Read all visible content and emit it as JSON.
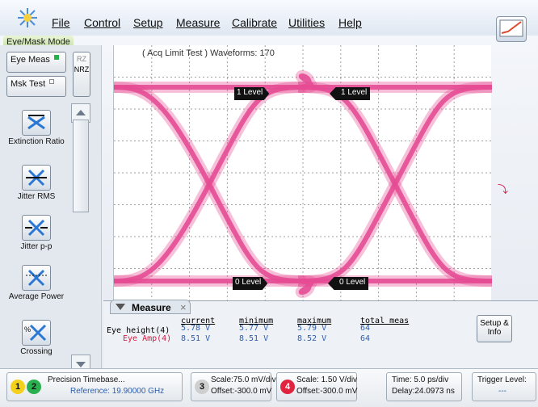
{
  "menubar": {
    "items": [
      "File",
      "Control",
      "Setup",
      "Measure",
      "Calibrate",
      "Utilities",
      "Help"
    ],
    "mode_label": "Eye/Mask Mode",
    "logo_icon": "starburst-icon",
    "help_icon": "oscilloscope-icon"
  },
  "left_panel": {
    "eye_meas_label": "Eye Meas",
    "msk_test_label": "Msk Test",
    "rz_label": "RZ",
    "nrz_label": "NRZ",
    "measurements": [
      {
        "label": "Extinction Ratio",
        "icon": "extinction-ratio-icon"
      },
      {
        "label": "Jitter RMS",
        "icon": "jitter-rms-icon"
      },
      {
        "label": "Jitter p-p",
        "icon": "jitter-pp-icon"
      },
      {
        "label": "Average Power",
        "icon": "average-power-icon"
      },
      {
        "label": "Crossing Percentage",
        "icon": "crossing-percentage-icon"
      }
    ]
  },
  "scope": {
    "acq_info": "( Acq Limit Test )  Waveforms: 170",
    "marker_1_level": "1 Level",
    "marker_0_level": "0 Level",
    "trace_color": "#e54b93"
  },
  "measure_panel": {
    "tab_label": "Measure",
    "headers": {
      "current": "current",
      "minimum": "minimum",
      "maximum": "maximum",
      "total_meas": "total meas"
    },
    "rows": [
      {
        "name": "Eye height(4)",
        "current": "5.78 V",
        "minimum": "5.77 V",
        "maximum": "5.79 V",
        "total": "64",
        "color": "#000000"
      },
      {
        "name": "Eye Amp(4)",
        "current": "8.51 V",
        "minimum": "8.51 V",
        "maximum": "8.52 V",
        "total": "64",
        "color": "#d71a41"
      }
    ],
    "setup_info_label": "Setup & Info"
  },
  "statusbar": {
    "ch1": "1",
    "ch2": "2",
    "timebase_title": "Precision Timebase...",
    "timebase_ref": "Reference: 19.90000 GHz",
    "ch3": "3",
    "ch3_scale": "Scale:75.0 mV/div",
    "ch3_offset": "Offset:-300.0 mV",
    "ch4": "4",
    "ch4_scale": "Scale: 1.50 V/div",
    "ch4_offset": "Offset:-300.0 mV",
    "time": "Time: 5.0 ps/div",
    "delay": "Delay:24.0973 ns",
    "trigger_label": "Trigger Level:",
    "trigger_value": "---"
  }
}
